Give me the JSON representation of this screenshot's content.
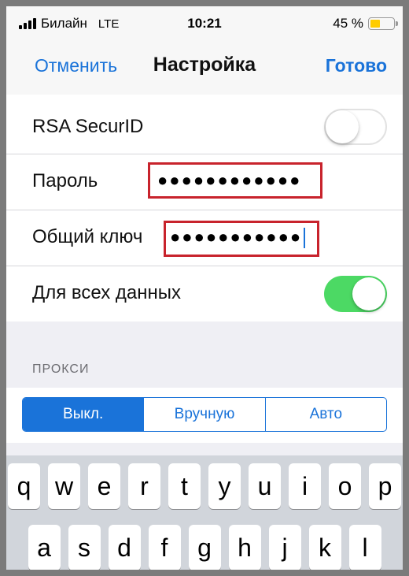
{
  "status_bar": {
    "carrier": "Билайн",
    "network": "LTE",
    "time": "10:21",
    "battery_percent": "45 %",
    "battery_level": 0.45,
    "battery_color": "#ffcc00"
  },
  "nav": {
    "cancel_label": "Отменить",
    "title": "Настройка",
    "done_label": "Готово"
  },
  "settings": {
    "rsa_label": "RSA SecurID",
    "rsa_toggle": false,
    "password_label": "Пароль",
    "password_value": "●●●●●●●●●●●●",
    "shared_key_label": "Общий ключ",
    "shared_key_value": "●●●●●●●●●●●",
    "all_data_label": "Для всех данных",
    "all_data_toggle": true
  },
  "proxy": {
    "header": "ПРОКСИ",
    "options": [
      "Выкл.",
      "Вручную",
      "Авто"
    ],
    "selected": "Выкл."
  },
  "keyboard": {
    "row1": [
      "q",
      "w",
      "e",
      "r",
      "t",
      "y",
      "u",
      "i",
      "o",
      "p"
    ],
    "row2": [
      "a",
      "s",
      "d",
      "f",
      "g",
      "h",
      "j",
      "k",
      "l"
    ]
  },
  "colors": {
    "accent": "#1a73d9",
    "toggle_on": "#4cd964",
    "highlight": "#c8232c"
  }
}
